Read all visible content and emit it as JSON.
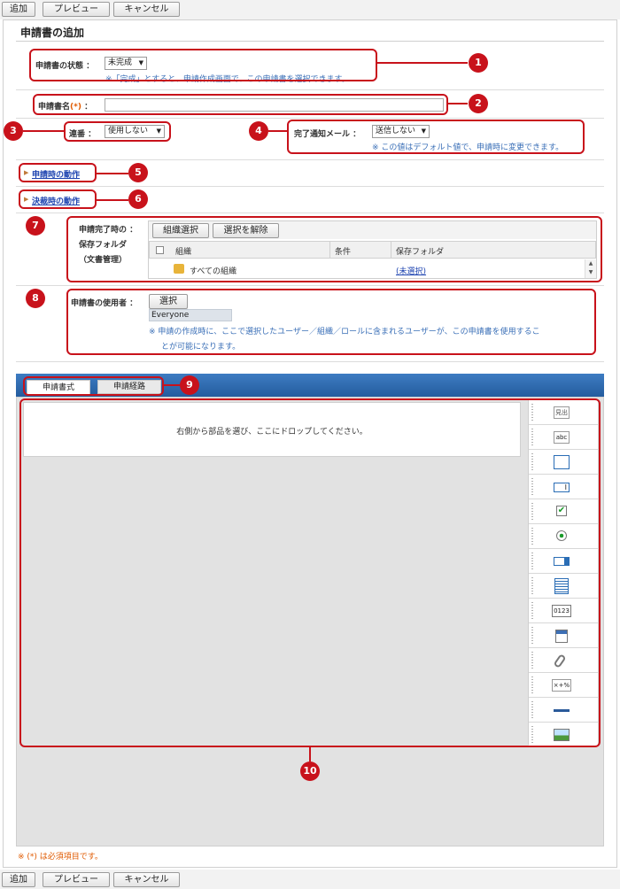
{
  "toolbar": {
    "add": "追加",
    "preview": "プレビュー",
    "cancel": "キャンセル"
  },
  "page_title": "申請書の追加",
  "status": {
    "label": "申請書の状態 ：",
    "value": "未完成",
    "note": "※「完成」とすると、申請作成画面で、この申請書を選択できます。"
  },
  "form_name": {
    "label": "申請書名",
    "required": "(*)",
    "colon": "：",
    "value": ""
  },
  "serial": {
    "label": "連番 ：",
    "value": "使用しない"
  },
  "notify": {
    "label": "完了通知メール ：",
    "value": "送信しない",
    "note": "※ この値はデフォルト値で、申請時に変更できます。"
  },
  "section_apply": "申請時の動作",
  "section_approve": "決裁時の動作",
  "save_folder": {
    "label_line1": "申請完了時の ：",
    "label_line2": "保存フォルダ",
    "label_line3": "（文書管理）",
    "btn_select_org": "組織選択",
    "btn_clear": "選択を解除",
    "columns": [
      "組織",
      "条件",
      "保存フォルダ"
    ],
    "rows": [
      {
        "org": "すべての組織",
        "condition": "",
        "folder": "(未選択)"
      }
    ]
  },
  "users": {
    "label": "申請書の使用者 ：",
    "btn_select": "選択",
    "selected": "Everyone",
    "note_line1": "※ 申請の作成時に、ここで選択したユーザー／組織／ロールに含まれるユーザーが、この申請書を使用するこ",
    "note_line2": "とが可能になります。"
  },
  "tabs": [
    {
      "label": "申請書式"
    },
    {
      "label": "申請経路"
    }
  ],
  "drop_hint": "右側から部品を選び、ここにドロップしてください。",
  "palette": [
    {
      "icon": "label-icon",
      "text": "見出"
    },
    {
      "icon": "text-abc-icon",
      "text": "abc"
    },
    {
      "icon": "textarea-icon",
      "text": ""
    },
    {
      "icon": "textbox-icon",
      "text": "I"
    },
    {
      "icon": "checkbox-icon",
      "text": "✔"
    },
    {
      "icon": "radio-icon",
      "text": ""
    },
    {
      "icon": "dropdown-icon",
      "text": ""
    },
    {
      "icon": "listbox-icon",
      "text": ""
    },
    {
      "icon": "number-icon",
      "text": "0123"
    },
    {
      "icon": "date-icon",
      "text": ""
    },
    {
      "icon": "attachment-icon",
      "text": ""
    },
    {
      "icon": "calc-icon",
      "text": "×+%"
    },
    {
      "icon": "separator-icon",
      "text": ""
    },
    {
      "icon": "image-icon",
      "text": ""
    }
  ],
  "markers": [
    "1",
    "2",
    "3",
    "4",
    "5",
    "6",
    "7",
    "8",
    "9",
    "10"
  ],
  "required_note": "※ (*) は必須項目です。",
  "colors": {
    "accent_red": "#c8121b",
    "link_blue": "#1d43b0",
    "note_blue": "#3a6fb7",
    "tab_bar": "#2f6bb0"
  }
}
